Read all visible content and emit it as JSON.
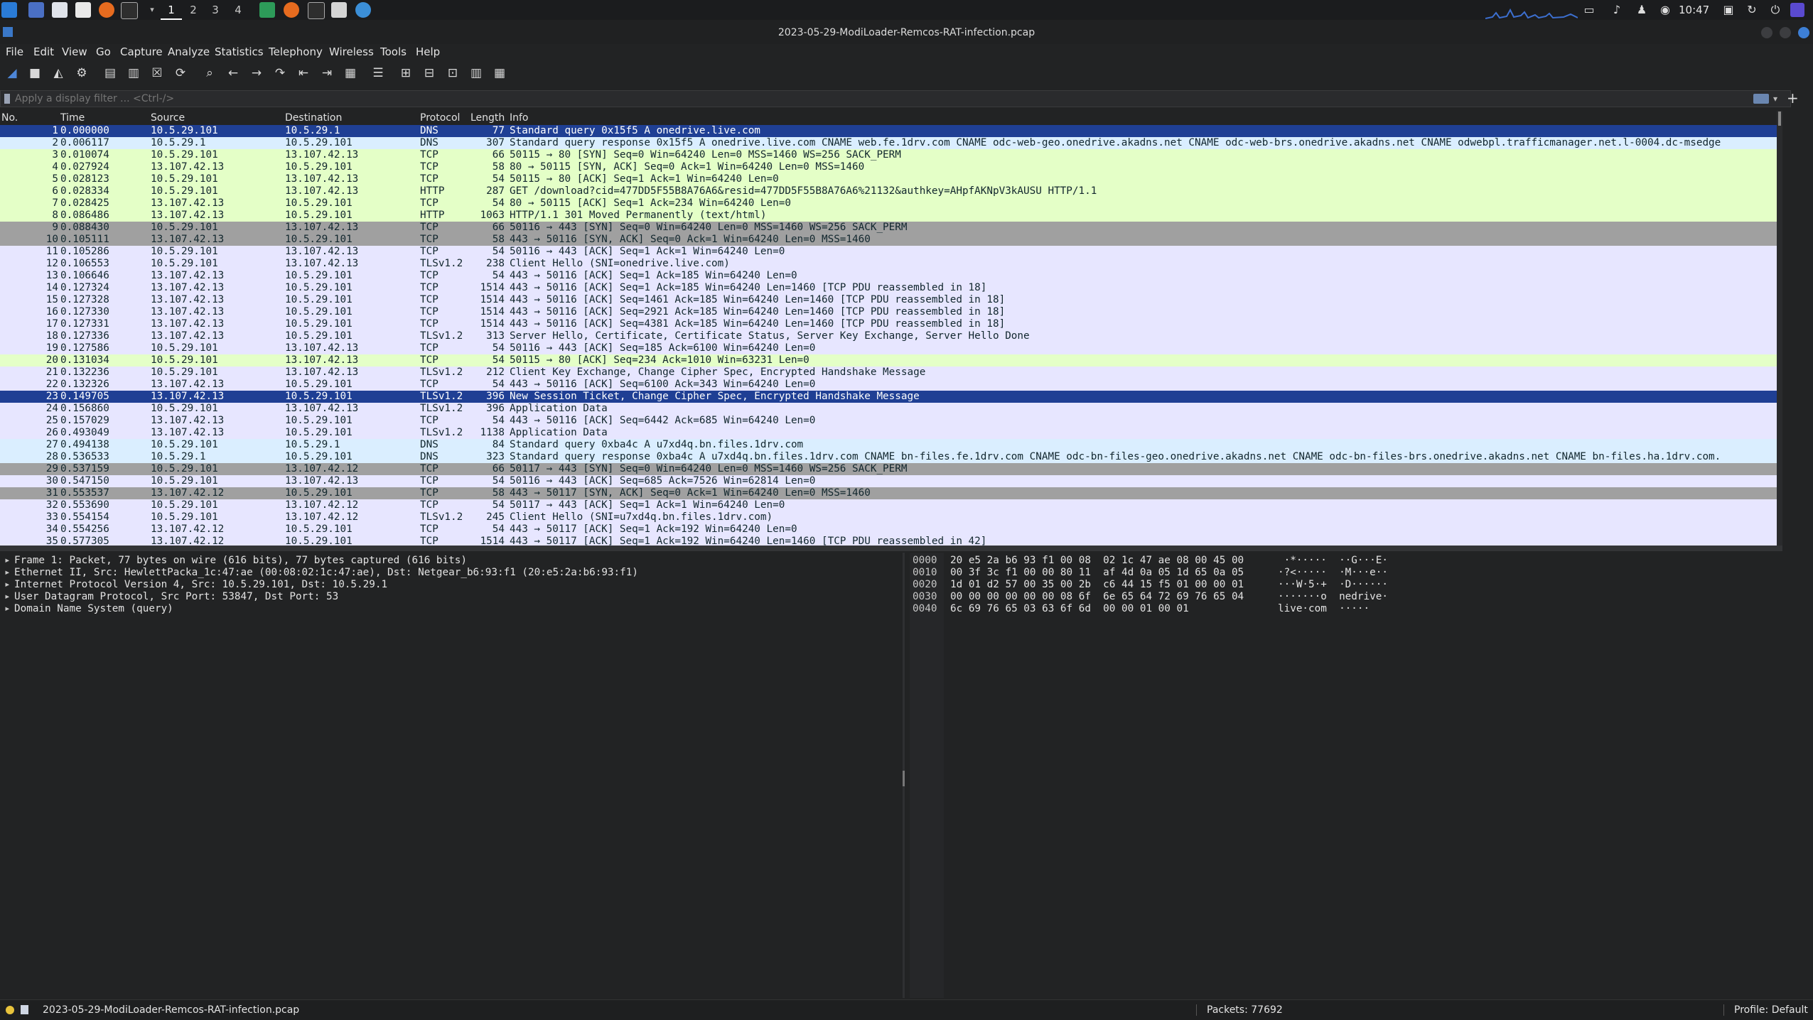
{
  "taskbar": {
    "workspaces": [
      "1",
      "2",
      "3",
      "4"
    ],
    "clock": "10:47"
  },
  "window": {
    "title": "2023-05-29-ModiLoader-Remcos-RAT-infection.pcap"
  },
  "menu": [
    "File",
    "Edit",
    "View",
    "Go",
    "Capture",
    "Analyze",
    "Statistics",
    "Telephony",
    "Wireless",
    "Tools",
    "Help"
  ],
  "filter": {
    "placeholder": "Apply a display filter ... <Ctrl-/>"
  },
  "packet_list": {
    "columns": [
      "No.",
      "Time",
      "Source",
      "Destination",
      "Protocol",
      "Length",
      "Info"
    ],
    "rows": [
      {
        "no": "1",
        "time": "0.000000",
        "src": "10.5.29.101",
        "dst": "10.5.29.1",
        "proto": "DNS",
        "len": "77",
        "info": "Standard query 0x15f5 A onedrive.live.com",
        "bg": "#e7e6ff",
        "sel": true
      },
      {
        "no": "2",
        "time": "0.006117",
        "src": "10.5.29.1",
        "dst": "10.5.29.101",
        "proto": "DNS",
        "len": "307",
        "info": "Standard query response 0x15f5 A onedrive.live.com CNAME web.fe.1drv.com CNAME odc-web-geo.onedrive.akadns.net CNAME odc-web-brs.onedrive.akadns.net CNAME odwebpl.trafficmanager.net.l-0004.dc-msedge",
        "bg": "#daeeff"
      },
      {
        "no": "3",
        "time": "0.010074",
        "src": "10.5.29.101",
        "dst": "13.107.42.13",
        "proto": "TCP",
        "len": "66",
        "info": "50115 → 80 [SYN] Seq=0 Win=64240 Len=0 MSS=1460 WS=256 SACK_PERM",
        "bg": "#e4ffc7"
      },
      {
        "no": "4",
        "time": "0.027924",
        "src": "13.107.42.13",
        "dst": "10.5.29.101",
        "proto": "TCP",
        "len": "58",
        "info": "80 → 50115 [SYN, ACK] Seq=0 Ack=1 Win=64240 Len=0 MSS=1460",
        "bg": "#e4ffc7"
      },
      {
        "no": "5",
        "time": "0.028123",
        "src": "10.5.29.101",
        "dst": "13.107.42.13",
        "proto": "TCP",
        "len": "54",
        "info": "50115 → 80 [ACK] Seq=1 Ack=1 Win=64240 Len=0",
        "bg": "#e4ffc7"
      },
      {
        "no": "6",
        "time": "0.028334",
        "src": "10.5.29.101",
        "dst": "13.107.42.13",
        "proto": "HTTP",
        "len": "287",
        "info": "GET /download?cid=477DD5F55B8A76A6&resid=477DD5F55B8A76A6%21132&authkey=AHpfAKNpV3kAUSU HTTP/1.1",
        "bg": "#e4ffc7"
      },
      {
        "no": "7",
        "time": "0.028425",
        "src": "13.107.42.13",
        "dst": "10.5.29.101",
        "proto": "TCP",
        "len": "54",
        "info": "80 → 50115 [ACK] Seq=1 Ack=234 Win=64240 Len=0",
        "bg": "#e4ffc7"
      },
      {
        "no": "8",
        "time": "0.086486",
        "src": "13.107.42.13",
        "dst": "10.5.29.101",
        "proto": "HTTP",
        "len": "1063",
        "info": "HTTP/1.1 301 Moved Permanently  (text/html)",
        "bg": "#e4ffc7"
      },
      {
        "no": "9",
        "time": "0.088430",
        "src": "10.5.29.101",
        "dst": "13.107.42.13",
        "proto": "TCP",
        "len": "66",
        "info": "50116 → 443 [SYN] Seq=0 Win=64240 Len=0 MSS=1460 WS=256 SACK_PERM",
        "bg": "#a0a0a0"
      },
      {
        "no": "10",
        "time": "0.105111",
        "src": "13.107.42.13",
        "dst": "10.5.29.101",
        "proto": "TCP",
        "len": "58",
        "info": "443 → 50116 [SYN, ACK] Seq=0 Ack=1 Win=64240 Len=0 MSS=1460",
        "bg": "#a0a0a0"
      },
      {
        "no": "11",
        "time": "0.105286",
        "src": "10.5.29.101",
        "dst": "13.107.42.13",
        "proto": "TCP",
        "len": "54",
        "info": "50116 → 443 [ACK] Seq=1 Ack=1 Win=64240 Len=0",
        "bg": "#e7e6ff"
      },
      {
        "no": "12",
        "time": "0.106553",
        "src": "10.5.29.101",
        "dst": "13.107.42.13",
        "proto": "TLSv1.2",
        "len": "238",
        "info": "Client Hello (SNI=onedrive.live.com)",
        "bg": "#e7e6ff"
      },
      {
        "no": "13",
        "time": "0.106646",
        "src": "13.107.42.13",
        "dst": "10.5.29.101",
        "proto": "TCP",
        "len": "54",
        "info": "443 → 50116 [ACK] Seq=1 Ack=185 Win=64240 Len=0",
        "bg": "#e7e6ff"
      },
      {
        "no": "14",
        "time": "0.127324",
        "src": "13.107.42.13",
        "dst": "10.5.29.101",
        "proto": "TCP",
        "len": "1514",
        "info": "443 → 50116 [ACK] Seq=1 Ack=185 Win=64240 Len=1460 [TCP PDU reassembled in 18]",
        "bg": "#e7e6ff"
      },
      {
        "no": "15",
        "time": "0.127328",
        "src": "13.107.42.13",
        "dst": "10.5.29.101",
        "proto": "TCP",
        "len": "1514",
        "info": "443 → 50116 [ACK] Seq=1461 Ack=185 Win=64240 Len=1460 [TCP PDU reassembled in 18]",
        "bg": "#e7e6ff"
      },
      {
        "no": "16",
        "time": "0.127330",
        "src": "13.107.42.13",
        "dst": "10.5.29.101",
        "proto": "TCP",
        "len": "1514",
        "info": "443 → 50116 [ACK] Seq=2921 Ack=185 Win=64240 Len=1460 [TCP PDU reassembled in 18]",
        "bg": "#e7e6ff"
      },
      {
        "no": "17",
        "time": "0.127331",
        "src": "13.107.42.13",
        "dst": "10.5.29.101",
        "proto": "TCP",
        "len": "1514",
        "info": "443 → 50116 [ACK] Seq=4381 Ack=185 Win=64240 Len=1460 [TCP PDU reassembled in 18]",
        "bg": "#e7e6ff"
      },
      {
        "no": "18",
        "time": "0.127336",
        "src": "13.107.42.13",
        "dst": "10.5.29.101",
        "proto": "TLSv1.2",
        "len": "313",
        "info": "Server Hello, Certificate, Certificate Status, Server Key Exchange, Server Hello Done",
        "bg": "#e7e6ff"
      },
      {
        "no": "19",
        "time": "0.127586",
        "src": "10.5.29.101",
        "dst": "13.107.42.13",
        "proto": "TCP",
        "len": "54",
        "info": "50116 → 443 [ACK] Seq=185 Ack=6100 Win=64240 Len=0",
        "bg": "#e7e6ff"
      },
      {
        "no": "20",
        "time": "0.131034",
        "src": "10.5.29.101",
        "dst": "13.107.42.13",
        "proto": "TCP",
        "len": "54",
        "info": "50115 → 80 [ACK] Seq=234 Ack=1010 Win=63231 Len=0",
        "bg": "#e4ffc7"
      },
      {
        "no": "21",
        "time": "0.132236",
        "src": "10.5.29.101",
        "dst": "13.107.42.13",
        "proto": "TLSv1.2",
        "len": "212",
        "info": "Client Key Exchange, Change Cipher Spec, Encrypted Handshake Message",
        "bg": "#e7e6ff"
      },
      {
        "no": "22",
        "time": "0.132326",
        "src": "13.107.42.13",
        "dst": "10.5.29.101",
        "proto": "TCP",
        "len": "54",
        "info": "443 → 50116 [ACK] Seq=6100 Ack=343 Win=64240 Len=0",
        "bg": "#e7e6ff"
      },
      {
        "no": "23",
        "time": "0.149705",
        "src": "13.107.42.13",
        "dst": "10.5.29.101",
        "proto": "TLSv1.2",
        "len": "396",
        "info": "New Session Ticket, Change Cipher Spec, Encrypted Handshake Message",
        "bg": "#1f3f94",
        "sel": true
      },
      {
        "no": "24",
        "time": "0.156860",
        "src": "10.5.29.101",
        "dst": "13.107.42.13",
        "proto": "TLSv1.2",
        "len": "396",
        "info": "Application Data",
        "bg": "#e7e6ff"
      },
      {
        "no": "25",
        "time": "0.157029",
        "src": "13.107.42.13",
        "dst": "10.5.29.101",
        "proto": "TCP",
        "len": "54",
        "info": "443 → 50116 [ACK] Seq=6442 Ack=685 Win=64240 Len=0",
        "bg": "#e7e6ff"
      },
      {
        "no": "26",
        "time": "0.493049",
        "src": "13.107.42.13",
        "dst": "10.5.29.101",
        "proto": "TLSv1.2",
        "len": "1138",
        "info": "Application Data",
        "bg": "#e7e6ff"
      },
      {
        "no": "27",
        "time": "0.494138",
        "src": "10.5.29.101",
        "dst": "10.5.29.1",
        "proto": "DNS",
        "len": "84",
        "info": "Standard query 0xba4c A u7xd4q.bn.files.1drv.com",
        "bg": "#daeeff"
      },
      {
        "no": "28",
        "time": "0.536533",
        "src": "10.5.29.1",
        "dst": "10.5.29.101",
        "proto": "DNS",
        "len": "323",
        "info": "Standard query response 0xba4c A u7xd4q.bn.files.1drv.com CNAME bn-files.fe.1drv.com CNAME odc-bn-files-geo.onedrive.akadns.net CNAME odc-bn-files-brs.onedrive.akadns.net CNAME bn-files.ha.1drv.com.",
        "bg": "#daeeff"
      },
      {
        "no": "29",
        "time": "0.537159",
        "src": "10.5.29.101",
        "dst": "13.107.42.12",
        "proto": "TCP",
        "len": "66",
        "info": "50117 → 443 [SYN] Seq=0 Win=64240 Len=0 MSS=1460 WS=256 SACK_PERM",
        "bg": "#a0a0a0"
      },
      {
        "no": "30",
        "time": "0.547150",
        "src": "10.5.29.101",
        "dst": "13.107.42.13",
        "proto": "TCP",
        "len": "54",
        "info": "50116 → 443 [ACK] Seq=685 Ack=7526 Win=62814 Len=0",
        "bg": "#e7e6ff"
      },
      {
        "no": "31",
        "time": "0.553537",
        "src": "13.107.42.12",
        "dst": "10.5.29.101",
        "proto": "TCP",
        "len": "58",
        "info": "443 → 50117 [SYN, ACK] Seq=0 Ack=1 Win=64240 Len=0 MSS=1460",
        "bg": "#a0a0a0"
      },
      {
        "no": "32",
        "time": "0.553690",
        "src": "10.5.29.101",
        "dst": "13.107.42.12",
        "proto": "TCP",
        "len": "54",
        "info": "50117 → 443 [ACK] Seq=1 Ack=1 Win=64240 Len=0",
        "bg": "#e7e6ff"
      },
      {
        "no": "33",
        "time": "0.554154",
        "src": "10.5.29.101",
        "dst": "13.107.42.12",
        "proto": "TLSv1.2",
        "len": "245",
        "info": "Client Hello (SNI=u7xd4q.bn.files.1drv.com)",
        "bg": "#e7e6ff"
      },
      {
        "no": "34",
        "time": "0.554256",
        "src": "13.107.42.12",
        "dst": "10.5.29.101",
        "proto": "TCP",
        "len": "54",
        "info": "443 → 50117 [ACK] Seq=1 Ack=192 Win=64240 Len=0",
        "bg": "#e7e6ff"
      },
      {
        "no": "35",
        "time": "0.577305",
        "src": "13.107.42.12",
        "dst": "10.5.29.101",
        "proto": "TCP",
        "len": "1514",
        "info": "443 → 50117 [ACK] Seq=1 Ack=192 Win=64240 Len=1460 [TCP PDU reassembled in 42]",
        "bg": "#e7e6ff"
      }
    ]
  },
  "details": [
    "Frame 1: Packet, 77 bytes on wire (616 bits), 77 bytes captured (616 bits)",
    "Ethernet II, Src: HewlettPacka_1c:47:ae (00:08:02:1c:47:ae), Dst: Netgear_b6:93:f1 (20:e5:2a:b6:93:f1)",
    "Internet Protocol Version 4, Src: 10.5.29.101, Dst: 10.5.29.1",
    "User Datagram Protocol, Src Port: 53847, Dst Port: 53",
    "Domain Name System (query)"
  ],
  "bytes": [
    {
      "off": "0000",
      "hex": "20 e5 2a b6 93 f1 00 08  02 1c 47 ae 08 00 45 00",
      "ascii": " ·*·····  ··G···E·"
    },
    {
      "off": "0010",
      "hex": "00 3f 3c f1 00 00 80 11  af 4d 0a 05 1d 65 0a 05",
      "ascii": "·?<·····  ·M···e··"
    },
    {
      "off": "0020",
      "hex": "1d 01 d2 57 00 35 00 2b  c6 44 15 f5 01 00 00 01",
      "ascii": "···W·5·+  ·D······"
    },
    {
      "off": "0030",
      "hex": "00 00 00 00 00 00 08 6f  6e 65 64 72 69 76 65 04",
      "ascii": "·······o  nedrive·"
    },
    {
      "off": "0040",
      "hex": "6c 69 76 65 03 63 6f 6d  00 00 01 00 01",
      "ascii": "live·com  ·····"
    }
  ],
  "status": {
    "file": "2023-05-29-ModiLoader-Remcos-RAT-infection.pcap",
    "packets": "Packets: 77692",
    "profile": "Profile: Default"
  },
  "colors": {
    "selection": "#1f3f94",
    "tcp_http": "#e4ffc7",
    "tls": "#e7e6ff",
    "dns": "#daeeff",
    "syn": "#a0a0a0"
  }
}
